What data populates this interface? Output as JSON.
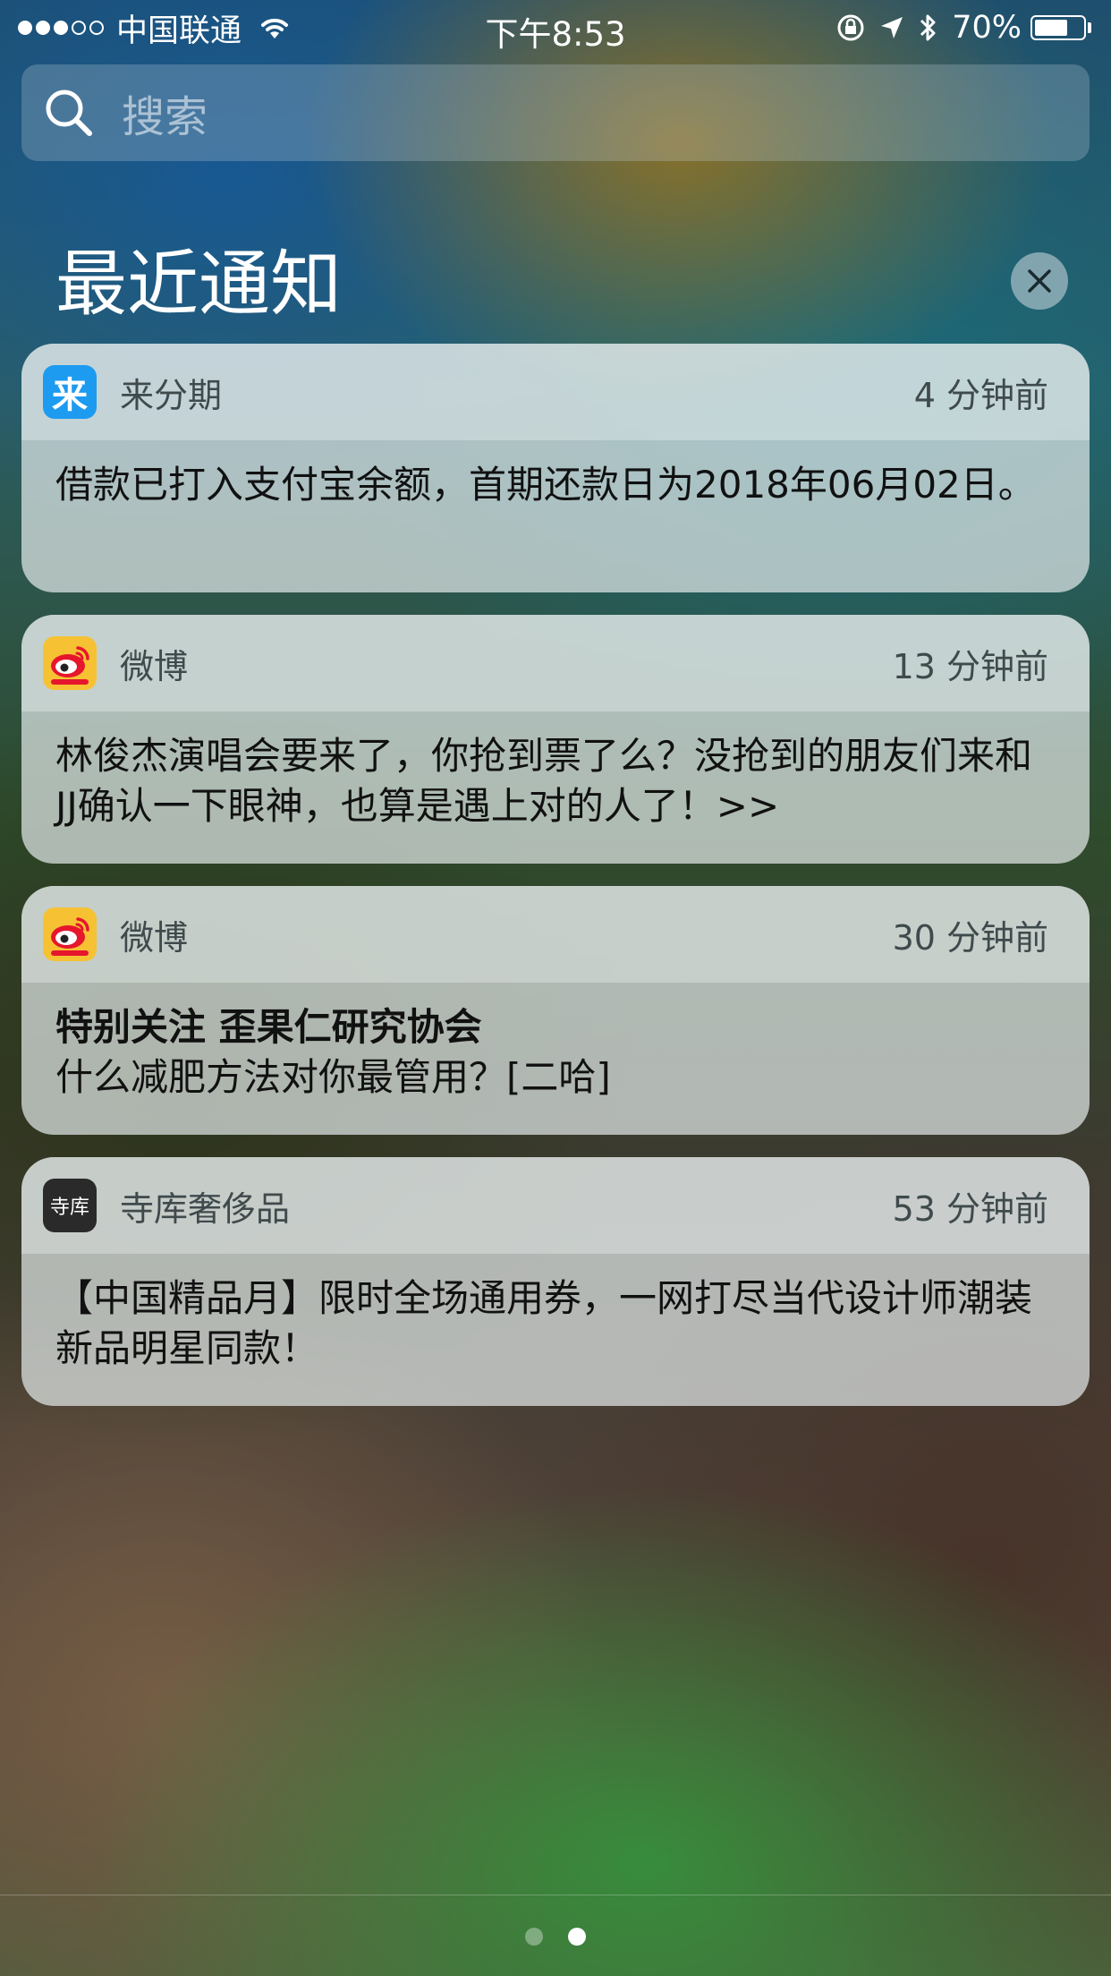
{
  "status_bar": {
    "signal_dots_filled": 3,
    "signal_dots_total": 5,
    "carrier": "中国联通",
    "time": "下午8:53",
    "battery_percent_label": "70%",
    "battery_level": 0.7,
    "icons": [
      "wifi-icon",
      "orientation-lock-icon",
      "location-icon",
      "bluetooth-icon",
      "battery-icon"
    ]
  },
  "search": {
    "placeholder": "搜索"
  },
  "section": {
    "title": "最近通知"
  },
  "notifications": [
    {
      "app": "来分期",
      "icon": "laifenqi-app-icon",
      "icon_glyph": "来",
      "time": "4 分钟前",
      "title": "",
      "body": "借款已打入支付宝余额，首期还款日为2018年06月02日。"
    },
    {
      "app": "微博",
      "icon": "weibo-app-icon",
      "time": "13 分钟前",
      "title": "",
      "body": "林俊杰演唱会要来了，你抢到票了么？没抢到的朋友们来和JJ确认一下眼神，也算是遇上对的人了！>>"
    },
    {
      "app": "微博",
      "icon": "weibo-app-icon",
      "time": "30 分钟前",
      "title": "特别关注 歪果仁研究协会",
      "body": "什么减肥方法对你最管用？[二哈]"
    },
    {
      "app": "寺库奢侈品",
      "icon": "siku-app-icon",
      "icon_glyph": "寺库",
      "time": "53 分钟前",
      "title": "",
      "body": "【中国精品月】限时全场通用券，一网打尽当代设计师潮装新品明星同款！"
    }
  ],
  "page_indicator": {
    "count": 2,
    "active_index": 1
  },
  "colors": {
    "laifenqi_blue": "#1c9bf0",
    "weibo_yellow": "#f6c233",
    "weibo_red": "#e6162d",
    "siku_black": "#2a2a2a"
  }
}
